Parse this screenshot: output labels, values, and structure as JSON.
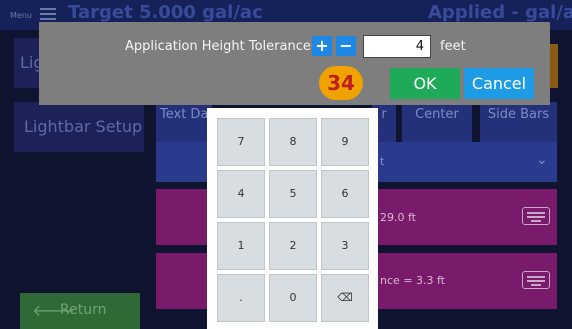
{
  "app": {
    "menu_label": "Menu",
    "target": "Target 5.000 gal/ac",
    "applied": "Applied - gal/ac"
  },
  "sidebar": {
    "top_button": "Lig",
    "lightbar_setup": "Lightbar Setup",
    "return": "Return"
  },
  "tabs": {
    "text_data": "Text Da",
    "partial": "r",
    "center": "Center",
    "side_bars": "Side Bars"
  },
  "dropdown": {
    "value_fragment": "t"
  },
  "rows": [
    {
      "text": "29.0 ft"
    },
    {
      "text": "nce = 3.3 ft"
    }
  ],
  "dialog": {
    "label": "Application Height Tolerance",
    "plus": "+",
    "minus": "−",
    "value": "4",
    "unit": "feet",
    "ok": "OK",
    "cancel": "Cancel",
    "step_badge": "34"
  },
  "keypad": {
    "keys": [
      "7",
      "8",
      "9",
      "4",
      "5",
      "6",
      "1",
      "2",
      "3",
      ".",
      "0",
      "⌫"
    ]
  },
  "colors": {
    "background": "#0f1530",
    "dialog": "#7e7e7e",
    "ok": "#1faa5a",
    "cancel": "#1e9be5",
    "badge": "#f0a200"
  }
}
